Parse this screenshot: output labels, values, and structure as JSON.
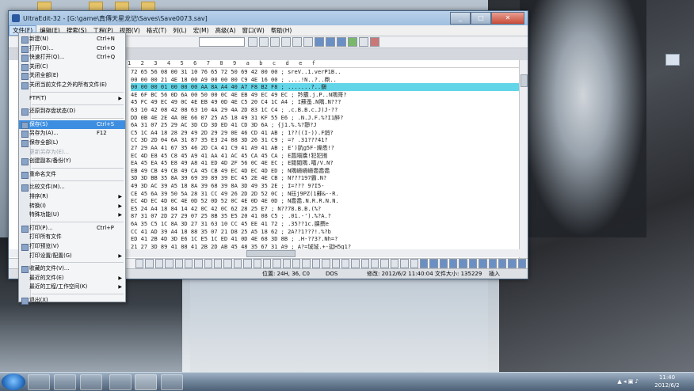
{
  "window": {
    "title": "UltraEdit-32 - [G:\\game\\真傳天星龙记\\Saves\\Save0073.sav]",
    "controls": {
      "minimize": "_",
      "maximize": "□",
      "close": "✕"
    }
  },
  "menubar": [
    "文件(F)",
    "编辑(E)",
    "搜索(S)",
    "工程(P)",
    "视图(V)",
    "格式(T)",
    "列(L)",
    "宏(M)",
    "高级(A)",
    "窗口(W)",
    "帮助(H)"
  ],
  "file_menu": [
    {
      "label": "新建(N)",
      "shortcut": "Ctrl+N",
      "icon": "new-icon"
    },
    {
      "label": "打开(O)...",
      "shortcut": "Ctrl+O",
      "icon": "open-icon"
    },
    {
      "label": "快速打开(Q)...",
      "shortcut": "Ctrl+Q",
      "icon": "quick-open-icon"
    },
    {
      "label": "关闭(C)",
      "shortcut": "",
      "icon": "close-file-icon"
    },
    {
      "label": "关闭全部(E)",
      "shortcut": "",
      "icon": "close-all-icon"
    },
    {
      "label": "关闭当前文件之外的所有文件(E)",
      "shortcut": "",
      "icon": "close-others-icon"
    },
    {
      "sep": true
    },
    {
      "label": "FTP(T)",
      "shortcut": "",
      "submenu": true
    },
    {
      "sep": true
    },
    {
      "label": "还原到存盘状态(D)",
      "shortcut": "",
      "icon": "revert-icon"
    },
    {
      "sep": true
    },
    {
      "label": "保存(S)",
      "shortcut": "Ctrl+S",
      "icon": "save-icon",
      "highlighted": true
    },
    {
      "label": "另存为(A)...",
      "shortcut": "F12",
      "icon": "save-as-icon"
    },
    {
      "label": "保存全部(L)",
      "shortcut": "",
      "icon": "save-all-icon"
    },
    {
      "label": "更新另存为(E)...",
      "shortcut": "",
      "disabled": true
    },
    {
      "label": "创建副本/备份(Y)",
      "shortcut": "",
      "icon": "backup-icon"
    },
    {
      "sep": true
    },
    {
      "label": "重命名文件",
      "shortcut": "",
      "icon": "rename-icon"
    },
    {
      "sep": true
    },
    {
      "label": "比较文件(M)...",
      "shortcut": "",
      "icon": "compare-icon"
    },
    {
      "label": "排序(R)",
      "shortcut": "",
      "submenu": true
    },
    {
      "label": "转换(I)",
      "shortcut": "",
      "submenu": true
    },
    {
      "label": "特殊功能(U)",
      "shortcut": "",
      "submenu": true
    },
    {
      "sep": true
    },
    {
      "label": "打印(P)...",
      "shortcut": "Ctrl+P",
      "icon": "print-icon"
    },
    {
      "label": "打印所有文件",
      "shortcut": ""
    },
    {
      "label": "打印预览(V)",
      "shortcut": "",
      "icon": "print-preview-icon"
    },
    {
      "label": "打印设置/配置(G)",
      "shortcut": "",
      "submenu": true
    },
    {
      "sep": true
    },
    {
      "label": "收藏的文件(V)...",
      "shortcut": "",
      "icon": "favorites-icon"
    },
    {
      "label": "最近的文件(E)",
      "shortcut": "",
      "submenu": true
    },
    {
      "label": "最近的工程/工作空间(K)",
      "shortcut": "",
      "submenu": true
    },
    {
      "sep": true
    },
    {
      "label": "退出(X)",
      "shortcut": "",
      "icon": "exit-icon"
    }
  ],
  "hex": {
    "ruler": "1 2 3 4 5 6 7 8 9 a b c d e f",
    "rows": [
      "72 65 56 08 00 31 10 76 65 72 50 69 42 00 00 ; sreV..1.verP1B..",
      "00 00 00 21 4E 18 00 A9 00 00 00 C9 4E 16 00 ; ....!N..?..鼎..",
      "00 00 00 01 00 00 00 AA 8A A4 40 A7 F8 B2 F8 ; .......?..鎭",
      "4E 6F BC 56 0D 6A 00 50 00 0C 4E EB 49 EC 49 EC ; 羚龗.j.P..N隅哥?",
      "45 FC 49 EC 49 0C 4E EB 49 0D 4E C5 20 C4 1C A4 ; I蘇蚤.N隅.N???",
      "63 10 42 08 42 08 63 10 4A 29 4A 2D 83 1C C4 ; .c.B.B.c.J)J-??",
      "DD 0B 4E 2E 4A 0E 66 07 25 A5 18 49 31 KF 55 E6 ; .N.J.F.%?I1醉?",
      "6A 31 07 25 29 AC 3D CD 3D ED 41 CD 3D 6A ; {j1.%.%?靜?J",
      "C5 1C A4 18 28 29 49 2D 29 29 0E 46 CD 41 AB ; 1??((I-)).F焇?",
      "CC 3D 2D 04 6A 31 87 35 E3 24 88 3D 26 31 C9 ; =? .31???41?",
      "27 29 AA 41 67 35 46 2D CA 41 C9 41 A9 41 AB ; E')肮g5F-燥悉!?",
      "EC 4D E8 45 C8 45 A9 41 AA 41 AC 45 CA 45 CA ; E菖隔嬌!犯犯捌",
      "EA 45 EA 45 E8 49 A8 41 ED 4D 2F 56 0C 4E EC ; E閱閱隅.嚆/V.N?",
      "EB 49 CB 49 CB 49 CA 45 CB 49 EC 4D EC 4D ED ; N隅嵴嵴嵴喬喬喬",
      "3D 3D BB 35 8A 39 69 39 89 39 EC 45 2E 4E CB ; N???197霸.N?",
      "49 3D AC 39 A5 18 8A 39 68 39 8A 3D 49 35 2E ; I=??? 9?I5-",
      "CE 45 6A 39 50 5A 28 31 CC 49 26 2D 2D 52 0C ; N珏j9PZ(1蘇&--R.",
      "EC 4D EC 4D 0C 4E 0D 52 0D 52 0C 4E 0D 4E 0D ; N喬喬.N.R.R.N.N.",
      "E5 24 A4 18 84 14 42 0C 42 0C 62 28 25 E7 ; N??78.B.B.(%?",
      "87 31 07 2D 27 29 07 25 8B 35 E5 20 41 08 C5 ; .01.-').%?A.?",
      "6A 35 C5 1C 8A 3D 27 31 63 10 CC 45 EE 41 72 ; .35??1c.腂撰e",
      "CC 41 AD 39 A4 18 88 35 07 21 D8 25 A5 18 62 ; 2A??1???!.%?b",
      "ED 41 2B 4D 3D E6 1C E5 1C ED 41 0D 4E 68 3D 8B ; .H-??3?.Nh=?",
      "21 27 3D 89 41 88 41 2B 2D AB 45 48 35 67 31 A9 ; A?=珹珹.+-珽H5g1?",
      "AB 45 AA 45 0C 4E AB 49 EB 45 CA 49 CA 49 AA ; E獏紞.N獏嗬屆 屆?"
    ],
    "highlight_row": 2
  },
  "status": {
    "position": "位置: 24H, 36, C0",
    "format": "DOS",
    "modified": "修改: 2012/6/2 11:40:04",
    "size": "文件大小: 135229",
    "mode": "插入"
  },
  "taskbar": {
    "time": "11:40",
    "date": "2012/6/2"
  }
}
